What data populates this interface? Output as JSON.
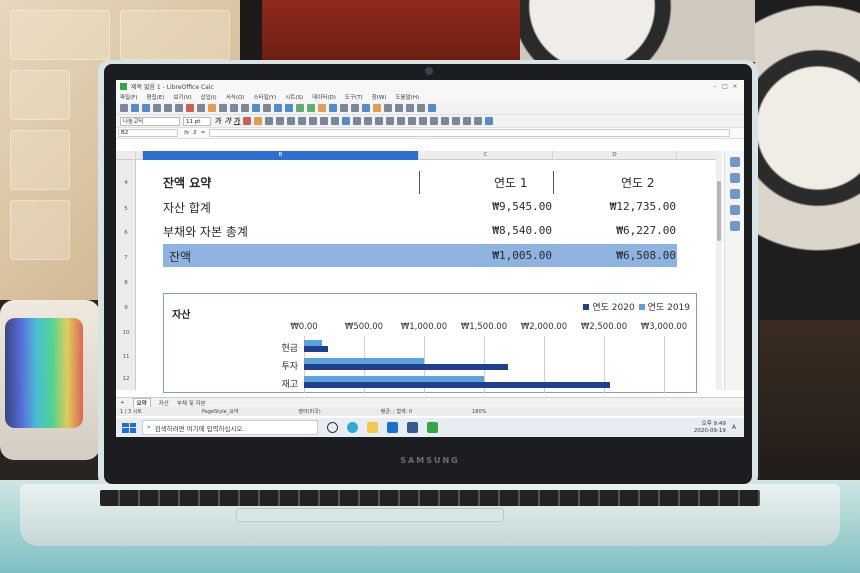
{
  "window": {
    "title": "제목 없음 1 - LibreOffice Calc",
    "menu": [
      "파일(F)",
      "편집(E)",
      "보기(V)",
      "삽입(I)",
      "서식(O)",
      "스타일(Y)",
      "시트(S)",
      "데이터(D)",
      "도구(T)",
      "창(W)",
      "도움말(H)"
    ]
  },
  "formatbar": {
    "font_name": "나눔고딕",
    "font_size": "11 pt",
    "bold": "가",
    "italic": "가",
    "underline": "가"
  },
  "namebar": {
    "cell_ref": "B2",
    "fx": "fx",
    "sum": "Σ",
    "equals": "="
  },
  "columns": [
    "B",
    "C",
    "D"
  ],
  "rows": [
    "4",
    "5",
    "6",
    "7",
    "8",
    "9",
    "10",
    "11",
    "12"
  ],
  "table": {
    "header": {
      "label": "잔액 요약",
      "col1": "연도 1",
      "col2": "연도 2"
    },
    "rows": [
      {
        "label": "자산 합계",
        "col1": "₩9,545.00",
        "col2": "₩12,735.00"
      },
      {
        "label": "부채와 자본 총계",
        "col1": "₩8,540.00",
        "col2": "₩6,227.00"
      },
      {
        "label": "잔액",
        "col1": "₩1,005.00",
        "col2": "₩6,508.00"
      }
    ]
  },
  "chart_data": {
    "type": "bar",
    "title": "자산",
    "orientation": "horizontal",
    "categories": [
      "현금",
      "투자",
      "재고"
    ],
    "series": [
      {
        "name": "연도 2020",
        "color": "#1f3f8f",
        "values": [
          200,
          1700,
          2550
        ]
      },
      {
        "name": "연도 2019",
        "color": "#5ea2dc",
        "values": [
          150,
          1000,
          1500
        ]
      }
    ],
    "xlim": [
      0,
      3000
    ],
    "xticks": [
      "₩0.00",
      "₩500.00",
      "₩1,000.00",
      "₩1,500.00",
      "₩2,000.00",
      "₩2,500.00",
      "₩3,000.00"
    ],
    "legend": "top-right",
    "grid": true
  },
  "tabs": {
    "add": "+",
    "sheets": [
      "요약",
      "자산",
      "부채 및 자본"
    ]
  },
  "statusbar": {
    "sheet_info": "1 / 3 시트",
    "page_style": "PageStyle_요약",
    "lang": "영어(미국)",
    "avg": "평균: ; 합계: 0",
    "zoom": "180%"
  },
  "taskbar": {
    "search_placeholder": "검색하려면 여기에 입력하십시오.",
    "time": "오후 9:49",
    "date": "2020-09-19",
    "ime": "A",
    "brand": "SAMSUNG"
  }
}
